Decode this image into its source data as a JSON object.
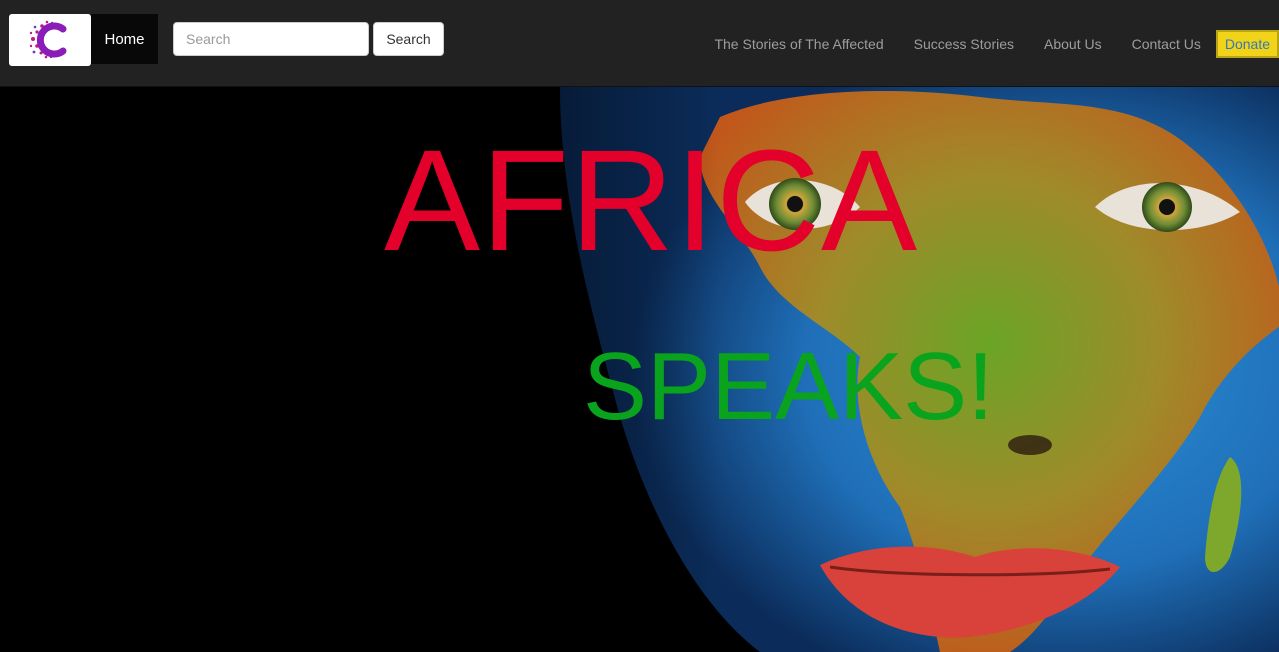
{
  "navbar": {
    "logo_icon": "colorful-c-logo-icon",
    "home_label": "Home",
    "search_placeholder": "Search",
    "search_button_label": "Search",
    "links": [
      {
        "label": "The Stories of The Affected"
      },
      {
        "label": "Success Stories"
      },
      {
        "label": "About Us"
      },
      {
        "label": "Contact Us"
      }
    ],
    "donate_label": "Donate",
    "colors": {
      "background": "#222222",
      "link": "#9d9d9d",
      "donate_bg": "#f1d31a",
      "donate_text": "#337ab7"
    }
  },
  "hero": {
    "title": "AFRICA",
    "subtitle": "SPEAKS!",
    "image": "face-painted-with-africa-map-image",
    "colors": {
      "title": "#e3002a",
      "subtitle": "#0aa31e",
      "background": "#000000"
    }
  }
}
